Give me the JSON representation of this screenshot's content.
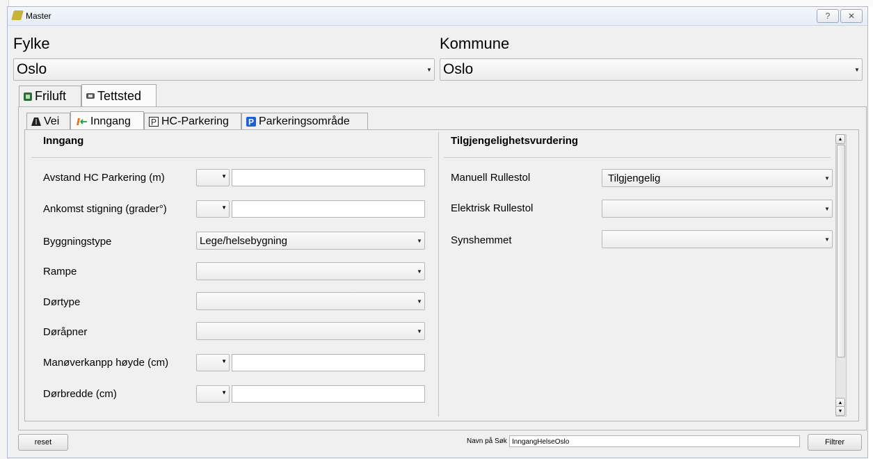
{
  "window": {
    "title": "Master",
    "help_glyph": "?",
    "close_glyph": "✕"
  },
  "fylke": {
    "label": "Fylke",
    "value": "Oslo"
  },
  "kommune": {
    "label": "Kommune",
    "value": "Oslo"
  },
  "outer_tabs": [
    {
      "label": "Friluft"
    },
    {
      "label": "Tettsted"
    }
  ],
  "inner_tabs": [
    {
      "label": "Vei"
    },
    {
      "label": "Inngang"
    },
    {
      "label": "HC-Parkering"
    },
    {
      "label": "Parkeringsområde"
    }
  ],
  "inngang": {
    "header": "Inngang",
    "rows": [
      {
        "label": "Avstand HC Parkering (m)",
        "value": ""
      },
      {
        "label": "Ankomst stigning (grader°)",
        "value": ""
      },
      {
        "label": "Byggningstype",
        "value": "Lege/helsebygning"
      },
      {
        "label": "Rampe",
        "value": ""
      },
      {
        "label": "Dørtype",
        "value": ""
      },
      {
        "label": "Døråpner",
        "value": ""
      },
      {
        "label": "Manøverkanpp høyde (cm)",
        "value": ""
      },
      {
        "label": "Dørbredde (cm)",
        "value": ""
      }
    ]
  },
  "vurdering": {
    "header": "Tilgjengelighetsvurdering",
    "rows": [
      {
        "label": "Manuell Rullestol",
        "value": "Tilgjengelig"
      },
      {
        "label": "Elektrisk Rullestol",
        "value": ""
      },
      {
        "label": "Synshemmet",
        "value": ""
      }
    ]
  },
  "footer": {
    "reset_label": "reset",
    "search_name_label": "Navn på Søk",
    "search_name_value": "InngangHelseOslo",
    "filter_label": "Filtrer"
  },
  "colors": {
    "accent_blue": "#1f5fd6",
    "icon_green": "#1d9a3a"
  }
}
